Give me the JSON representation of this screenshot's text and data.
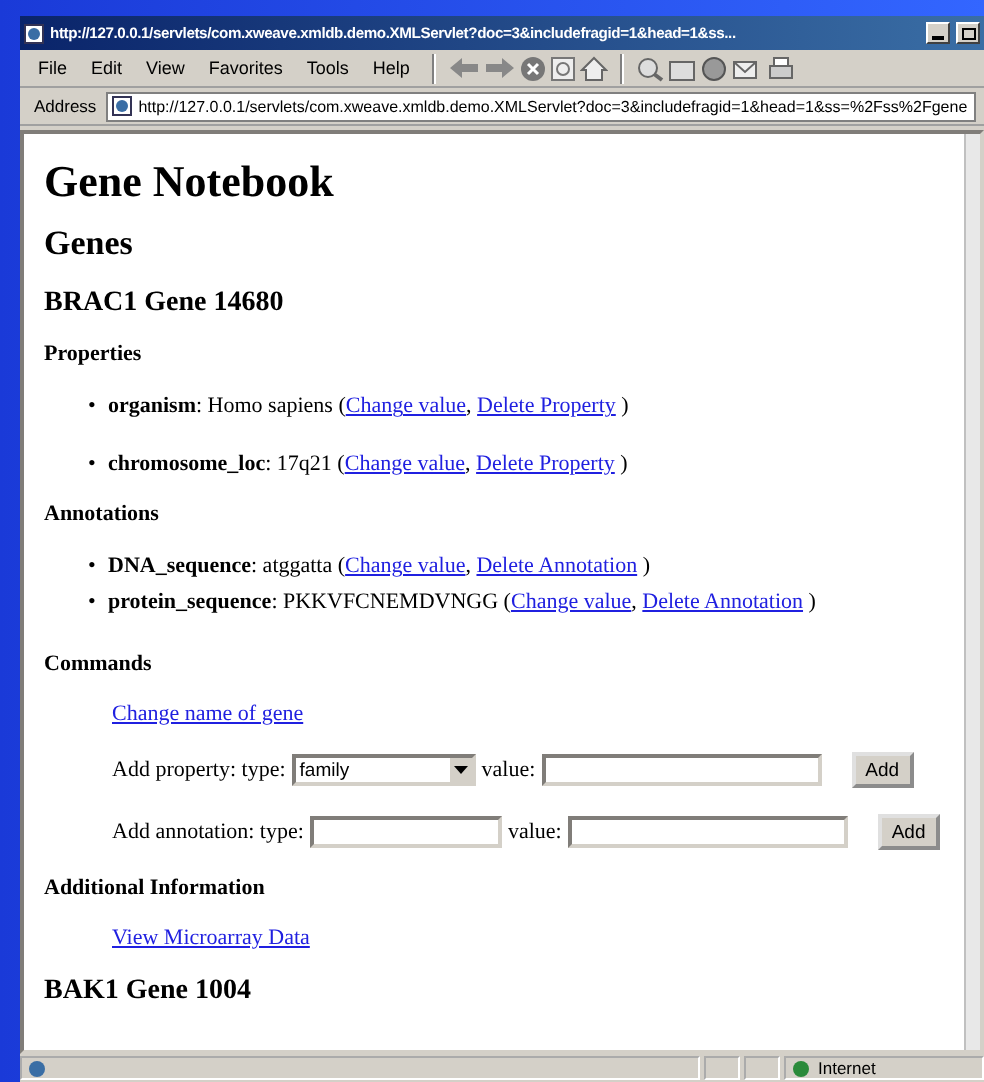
{
  "window": {
    "title": "http://127.0.0.1/servlets/com.xweave.xmldb.demo.XMLServlet?doc=3&includefragid=1&head=1&ss..."
  },
  "menu": [
    "File",
    "Edit",
    "View",
    "Favorites",
    "Tools",
    "Help"
  ],
  "address": {
    "label": "Address",
    "value": "http://127.0.0.1/servlets/com.xweave.xmldb.demo.XMLServlet?doc=3&includefragid=1&head=1&ss=%2Fss%2Fgene"
  },
  "page": {
    "title": "Gene Notebook",
    "section": "Genes",
    "gene": "BRAC1 Gene 14680",
    "properties": {
      "heading": "Properties",
      "items": [
        {
          "marker": "•",
          "text": "**organism**: Homo sapiens (",
          "links": [
            "Change value",
            "Delete Property"
          ],
          "separators": [
            ",",
            ")"
          ]
        },
        {
          "marker": "•",
          "text": "**chromosome_loc**: 17q21 (",
          "links": [
            "Change value",
            "Delete Property"
          ],
          "separators": [
            ",",
            ")"
          ]
        }
      ]
    },
    "annotations": {
      "heading": "Annotations",
      "items": [
        {
          "marker": "•",
          "text": "**DNA_sequence**: atggatta (",
          "links": [
            "Change value",
            "Delete Annotation"
          ],
          "separators": [
            ",",
            ")"
          ]
        },
        {
          "marker": "•",
          "text": "**protein_sequence**: PKKVFCNEMDVNGG (",
          "links": [
            "Change value",
            "Delete Annotation"
          ],
          "separators": [
            ",",
            ")"
          ]
        }
      ]
    },
    "commands": {
      "heading": "Commands",
      "rename_link": "Change name of gene",
      "add_property": {
        "label": "Add property: type:",
        "type_value": "family",
        "value_label": "value:",
        "button": "Add"
      },
      "add_annotation": {
        "label": "Add annotation: type:",
        "value_label": "value:",
        "button": "Add"
      }
    },
    "additional": {
      "heading": "Additional Information",
      "link": "View Microarray Data"
    },
    "next_gene": "BAK1 Gene 1004"
  },
  "status_bar": {
    "zone": "Internet"
  }
}
